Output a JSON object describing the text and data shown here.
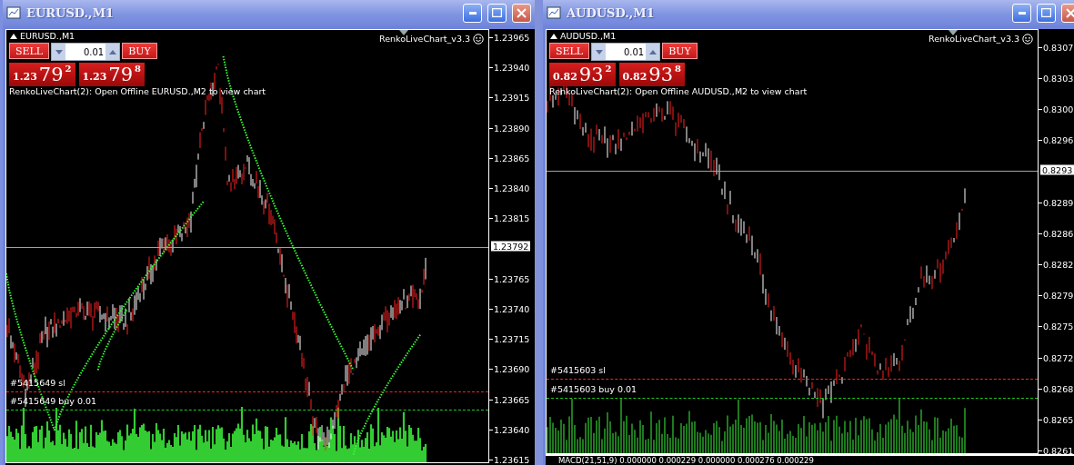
{
  "windows": [
    {
      "title": "EURUSD.,M1",
      "symbol": "EURUSD.,M1",
      "indicator": "RenkoLiveChart_v3.3",
      "sell": "SELL",
      "buy": "BUY",
      "lot": "0.01",
      "bid": {
        "big": "1.23",
        "pips": "79",
        "frac": "2"
      },
      "ask": {
        "big": "1.23",
        "pips": "79",
        "frac": "8"
      },
      "message": "RenkoLiveChart(2): Open Offline EURUSD.,M2 to view chart",
      "price_ticks": [
        "1.23965",
        "1.23940",
        "1.23915",
        "1.23890",
        "1.23865",
        "1.23840",
        "1.23815",
        "1.23765",
        "1.23740",
        "1.23715",
        "1.23690",
        "1.23665",
        "1.23640",
        "1.23615"
      ],
      "current_price": "1.23792",
      "trade_lines": [
        {
          "kind": "sl",
          "label": "#5415649 sl"
        },
        {
          "kind": "entry",
          "label": "#5415649 buy 0.01"
        }
      ]
    },
    {
      "title": "AUDUSD.,M1",
      "symbol": "AUDUSD.,M1",
      "indicator": "RenkoLiveChart_v3.3",
      "sell": "SELL",
      "buy": "BUY",
      "lot": "0.01",
      "bid": {
        "big": "0.82",
        "pips": "93",
        "frac": "2"
      },
      "ask": {
        "big": "0.82",
        "pips": "93",
        "frac": "8"
      },
      "message": "RenkoLiveChart(2): Open Offline AUDUSD.,M2 to view chart",
      "price_ticks": [
        "0.8307",
        "0.8303",
        "0.8300",
        "0.8296",
        "0.8289",
        "0.8286",
        "0.8282",
        "0.8279",
        "0.8275",
        "0.8272",
        "0.8268",
        "0.8265",
        "0.8261"
      ],
      "current_price": "0.8293",
      "trade_lines": [
        {
          "kind": "sl",
          "label": "#5415603 sl"
        },
        {
          "kind": "entry",
          "label": "#5415603 buy 0.01"
        }
      ],
      "subwindow": "MACD(21,51,9) 0.000000 0.000229 0.000000 0.000276 0.000229"
    }
  ]
}
